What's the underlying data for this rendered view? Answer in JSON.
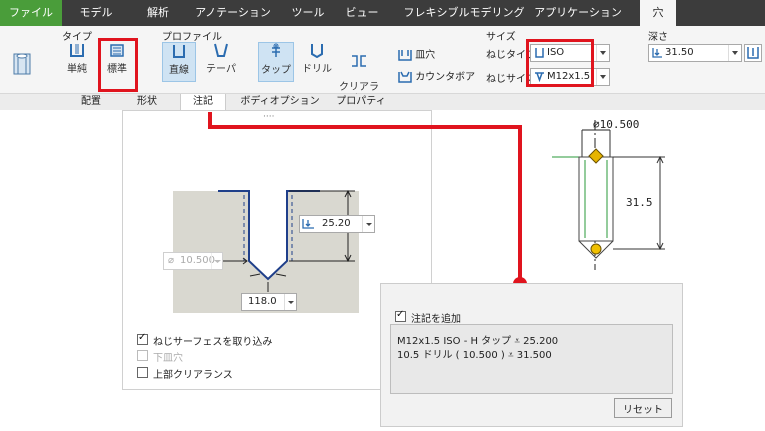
{
  "menu": {
    "tabs": [
      "ファイル",
      "モデル",
      "解析",
      "アノテーション",
      "ツール",
      "ビュー",
      "フレキシブルモデリング",
      "アプリケーション",
      "穴"
    ]
  },
  "ribbon": {
    "type": {
      "label": "タイプ",
      "simple": "単純",
      "standard": "標準"
    },
    "profile": {
      "label": "プロファイル",
      "straight": "直線",
      "taper": "テーパ",
      "tap": "タップ",
      "drill": "ドリル",
      "clearance": "クリアラン\nス",
      "counterbore": "皿穴",
      "countersink": "カウンタボア"
    },
    "size": {
      "label": "サイズ",
      "thread_type_label": "ねじタイプ:",
      "thread_type_value": "ISO",
      "thread_size_label": "ねじサイズ:",
      "thread_size_value": "M12x1.5"
    },
    "depth": {
      "label": "深さ",
      "value": "31.50"
    }
  },
  "subtabs": [
    "配置",
    "形状",
    "注記",
    "ボディオプション",
    "プロパティ"
  ],
  "panel": {
    "grip": "····",
    "preview": {
      "depth_value": "25.20",
      "diameter_value": "10.500",
      "angle_value": "118.0"
    },
    "include_thread_surface": "ねじサーフェスを取り込み",
    "lower_countersink": "下皿穴",
    "upper_clearance": "上部クリアランス"
  },
  "popup": {
    "add_note": "注記を追加",
    "note_line1": "M12x1.5 ISO - H タップ ⩡ 25.200",
    "note_line2": "10.5 ドリル ( 10.500 ) ⩡ 31.500",
    "reset": "リセット"
  },
  "drawing": {
    "diameter": "⌀10.500",
    "depth": "31.5"
  },
  "colors": {
    "highlight_red": "#e0141e",
    "file_tab_green": "#4a9d3a",
    "icon_blue": "#2b6cb0"
  }
}
